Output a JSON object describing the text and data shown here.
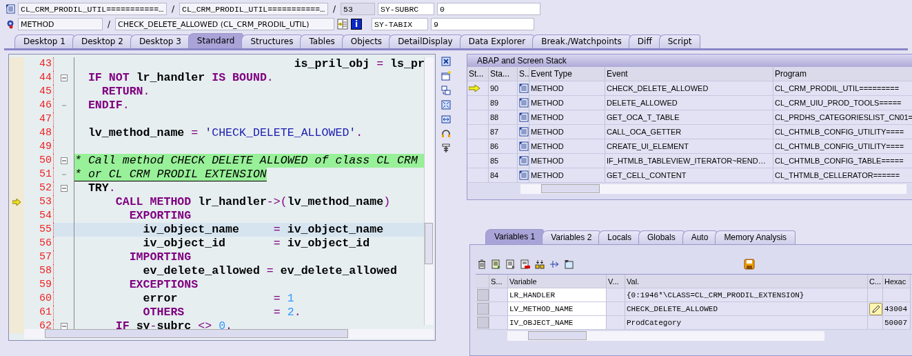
{
  "header": {
    "row1": [
      {
        "kind": "icon-field",
        "text": "CL_CRM_PRODIL_UTIL===========…"
      },
      {
        "kind": "sep",
        "text": "/"
      },
      {
        "kind": "field",
        "text": "CL_CRM_PRODIL_UTIL===========…"
      },
      {
        "kind": "sep",
        "text": "/"
      },
      {
        "kind": "field",
        "text": "53"
      },
      {
        "kind": "field",
        "text": "SY-SUBRC"
      },
      {
        "kind": "field",
        "text": "0"
      }
    ],
    "row2": [
      {
        "kind": "icon-field",
        "text": "METHOD"
      },
      {
        "kind": "sep",
        "text": "/"
      },
      {
        "kind": "field",
        "text": "CHECK_DELETE_ALLOWED (CL_CRM_PRODIL_UTIL)"
      },
      {
        "kind": "buttons",
        "text": "i"
      },
      {
        "kind": "field",
        "text": "SY-TABIX"
      },
      {
        "kind": "field",
        "text": "9"
      }
    ]
  },
  "tabs": [
    {
      "label": "Desktop 1",
      "selected": false
    },
    {
      "label": "Desktop 2",
      "selected": false
    },
    {
      "label": "Desktop 3",
      "selected": false
    },
    {
      "label": "Standard",
      "selected": true
    },
    {
      "label": "Structures",
      "selected": false
    },
    {
      "label": "Tables",
      "selected": false
    },
    {
      "label": "Objects",
      "selected": false
    },
    {
      "label": "DetailDisplay",
      "selected": false
    },
    {
      "label": "Data Explorer",
      "selected": false
    },
    {
      "label": "Break./Watchpoints",
      "selected": false
    },
    {
      "label": "Diff",
      "selected": false
    },
    {
      "label": "Script",
      "selected": false
    }
  ],
  "code": {
    "lines": [
      {
        "number": "43",
        "kind": "plain",
        "current": false,
        "cursor": false,
        "segments": [
          {
            "kind": "id",
            "text": "                                is_pril_obj "
          },
          {
            "kind": "op",
            "text": "="
          },
          {
            "kind": "id",
            "text": " ls_pr"
          }
        ]
      },
      {
        "number": "44",
        "kind": "block-start",
        "current": false,
        "cursor": false,
        "segments": [
          {
            "kind": "kw",
            "text": "  IF NOT"
          },
          {
            "kind": "id",
            "text": " lr_handler "
          },
          {
            "kind": "kw",
            "text": "IS BOUND"
          },
          {
            "kind": "op",
            "text": "."
          }
        ]
      },
      {
        "number": "45",
        "kind": "plain",
        "current": false,
        "cursor": false,
        "segments": [
          {
            "kind": "kw",
            "text": "    RETURN"
          },
          {
            "kind": "op",
            "text": "."
          }
        ]
      },
      {
        "number": "46",
        "kind": "block-end",
        "current": false,
        "cursor": false,
        "segments": [
          {
            "kind": "kw",
            "text": "  ENDIF"
          },
          {
            "kind": "op",
            "text": "."
          }
        ]
      },
      {
        "number": "47",
        "kind": "plain",
        "current": false,
        "cursor": false
      },
      {
        "number": "48",
        "kind": "plain",
        "current": false,
        "cursor": false,
        "segments": [
          {
            "kind": "id",
            "text": "  lv_method_name "
          },
          {
            "kind": "op",
            "text": "="
          },
          {
            "kind": "str",
            "text": " 'CHECK_DELETE_ALLOWED'"
          },
          {
            "kind": "op",
            "text": "."
          }
        ]
      },
      {
        "number": "49",
        "kind": "plain",
        "current": false,
        "cursor": false
      },
      {
        "number": "50",
        "kind": "block-start",
        "current": false,
        "cursor": false,
        "segments": [
          {
            "kind": "comment-full",
            "text": "* Call method CHECK DELETE ALLOWED of class CL CRM"
          }
        ]
      },
      {
        "number": "51",
        "kind": "block-end",
        "current": false,
        "cursor": false,
        "segments": [
          {
            "kind": "comment",
            "text": "* or CL CRM PRODIL EXTENSION"
          }
        ]
      },
      {
        "number": "52",
        "kind": "block-start",
        "current": false,
        "cursor": false,
        "segments": [
          {
            "kind": "id",
            "text": "  TRY"
          },
          {
            "kind": "op",
            "text": "."
          }
        ]
      },
      {
        "number": "53",
        "kind": "plain",
        "current": true,
        "cursor": false,
        "segments": [
          {
            "kind": "kw",
            "text": "      CALL METHOD"
          },
          {
            "kind": "id",
            "text": " lr_handler"
          },
          {
            "kind": "op",
            "text": "->("
          },
          {
            "kind": "id",
            "text": "lv_method_name"
          },
          {
            "kind": "op",
            "text": ")"
          }
        ]
      },
      {
        "number": "54",
        "kind": "plain",
        "current": false,
        "cursor": false,
        "segments": [
          {
            "kind": "kw",
            "text": "        EXPORTING"
          }
        ]
      },
      {
        "number": "55",
        "kind": "plain",
        "current": false,
        "cursor": true,
        "segments": [
          {
            "kind": "id",
            "text": "          iv_object_name     "
          },
          {
            "kind": "op",
            "text": "="
          },
          {
            "kind": "id",
            "text": " iv_object_name"
          }
        ]
      },
      {
        "number": "56",
        "kind": "plain",
        "current": false,
        "cursor": false,
        "segments": [
          {
            "kind": "id",
            "text": "          iv_object_id       "
          },
          {
            "kind": "op",
            "text": "="
          },
          {
            "kind": "id",
            "text": " iv_object_id"
          }
        ]
      },
      {
        "number": "57",
        "kind": "plain",
        "current": false,
        "cursor": false,
        "segments": [
          {
            "kind": "kw",
            "text": "        IMPORTING"
          }
        ]
      },
      {
        "number": "58",
        "kind": "plain",
        "current": false,
        "cursor": false,
        "segments": [
          {
            "kind": "id",
            "text": "          ev_delete_allowed "
          },
          {
            "kind": "op",
            "text": "="
          },
          {
            "kind": "id",
            "text": " ev_delete_allowed"
          }
        ]
      },
      {
        "number": "59",
        "kind": "plain",
        "current": false,
        "cursor": false,
        "segments": [
          {
            "kind": "kw",
            "text": "        EXCEPTIONS"
          }
        ]
      },
      {
        "number": "60",
        "kind": "plain",
        "current": false,
        "cursor": false,
        "segments": [
          {
            "kind": "id",
            "text": "          error              "
          },
          {
            "kind": "op",
            "text": "="
          },
          {
            "kind": "num",
            "text": " 1"
          }
        ]
      },
      {
        "number": "61",
        "kind": "plain",
        "current": false,
        "cursor": false,
        "segments": [
          {
            "kind": "kw",
            "text": "          OTHERS             "
          },
          {
            "kind": "op",
            "text": "="
          },
          {
            "kind": "num",
            "text": " 2"
          },
          {
            "kind": "op",
            "text": "."
          }
        ]
      },
      {
        "number": "62",
        "kind": "block-start",
        "current": false,
        "cursor": false,
        "segments": [
          {
            "kind": "kw",
            "text": "      IF"
          },
          {
            "kind": "id",
            "text": " sy"
          },
          {
            "kind": "op",
            "text": "-"
          },
          {
            "kind": "id",
            "text": "subrc "
          },
          {
            "kind": "op",
            "text": "<>"
          },
          {
            "kind": "num",
            "text": " 0"
          },
          {
            "kind": "op",
            "text": "."
          }
        ]
      }
    ]
  },
  "stack": {
    "title": "ABAP and Screen Stack",
    "columns": [
      "St...",
      "Sta...",
      "S..",
      "Event Type",
      "Event",
      "Program"
    ],
    "rows": [
      {
        "current": true,
        "level": "90",
        "event_type": "METHOD",
        "event": "CHECK_DELETE_ALLOWED",
        "program": "CL_CRM_PRODIL_UTIL========="
      },
      {
        "current": false,
        "level": "89",
        "event_type": "METHOD",
        "event": "DELETE_ALLOWED",
        "program": "CL_CRM_UIU_PROD_TOOLS====="
      },
      {
        "current": false,
        "level": "88",
        "event_type": "METHOD",
        "event": "GET_OCA_T_TABLE",
        "program": "CL_PRDHS_CATEGORIESLIST_CN01="
      },
      {
        "current": false,
        "level": "87",
        "event_type": "METHOD",
        "event": "CALL_OCA_GETTER",
        "program": "CL_CHTMLB_CONFIG_UTILITY===="
      },
      {
        "current": false,
        "level": "86",
        "event_type": "METHOD",
        "event": "CREATE_UI_ELEMENT",
        "program": "CL_CHTMLB_CONFIG_UTILITY===="
      },
      {
        "current": false,
        "level": "85",
        "event_type": "METHOD",
        "event": "IF_HTMLB_TABLEVIEW_ITERATOR~REND…",
        "program": "CL_CHTMLB_CONFIG_TABLE====="
      },
      {
        "current": false,
        "level": "84",
        "event_type": "METHOD",
        "event": "GET_CELL_CONTENT",
        "program": "CL_THTMLB_CELLERATOR======"
      }
    ]
  },
  "var_tabs": [
    {
      "label": "Variables 1",
      "selected": true
    },
    {
      "label": "Variables 2",
      "selected": false
    },
    {
      "label": "Locals",
      "selected": false
    },
    {
      "label": "Globals",
      "selected": false
    },
    {
      "label": "Auto",
      "selected": false
    },
    {
      "label": "Memory Analysis",
      "selected": false
    }
  ],
  "variables": {
    "columns": [
      "S...",
      "Variable",
      "V...",
      "Val.",
      "C...",
      "Hexac"
    ],
    "rows": [
      {
        "name": "LR_HANDLER",
        "value": "{0:1946*\\CLASS=CL_CRM_PRODIL_EXTENSION}",
        "editable": false
      },
      {
        "name": "LV_METHOD_NAME",
        "value": "CHECK_DELETE_ALLOWED",
        "editable": true,
        "hex": "43004"
      },
      {
        "name": "IV_OBJECT_NAME",
        "value": "ProdCategory",
        "editable": false,
        "hex": "50007"
      }
    ]
  }
}
